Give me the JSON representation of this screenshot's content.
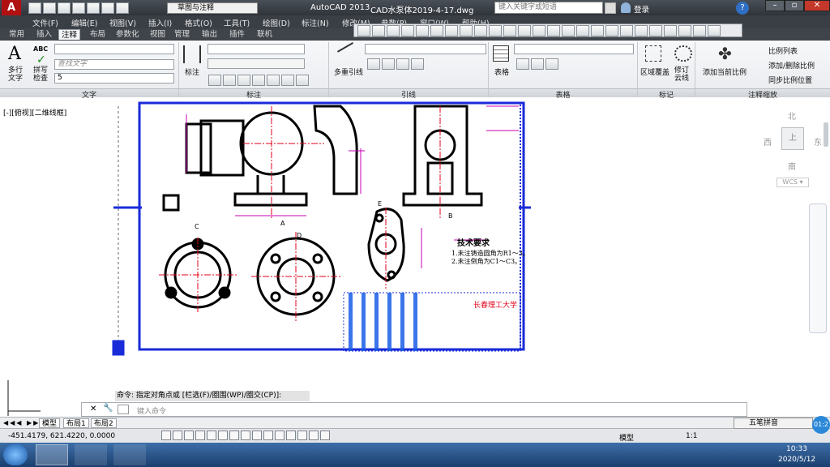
{
  "titlebar": {
    "workspace": "草图与注释",
    "app_title": "AutoCAD 2013",
    "file_title": "CAD水泵体2019-4-17.dwg",
    "search_placeholder": "键入关键字或短语",
    "login": "登录"
  },
  "menu": [
    "文件(F)",
    "编辑(E)",
    "视图(V)",
    "插入(I)",
    "格式(O)",
    "工具(T)",
    "绘图(D)",
    "标注(N)",
    "修改(M)",
    "参数(P)",
    "窗口(W)",
    "帮助(H)"
  ],
  "tabs": [
    "常用",
    "插入",
    "注释",
    "布局",
    "参数化",
    "视图",
    "管理",
    "输出",
    "插件",
    "联机"
  ],
  "active_tab": "注释",
  "ribbon": {
    "text_panel": {
      "title": "文字",
      "multiline_text": "多行文字",
      "spell_check": "拼写检查",
      "abc": "ABC",
      "find_placeholder": "查找文字",
      "height_value": "5"
    },
    "dim_panel": {
      "title": "标注",
      "dim_label": "标注"
    },
    "leader_panel": {
      "title": "引线",
      "multileader": "多重引线"
    },
    "table_panel": {
      "title": "表格",
      "table": "表格"
    },
    "markup_panel": {
      "title": "标记",
      "wipeout": "区域覆盖",
      "revcloud": "修订云线"
    },
    "scale_panel": {
      "title": "注释缩放",
      "add_current": "添加当前比例",
      "scale_list": "比例列表",
      "add_delete": "添加/删除比例",
      "sync": "同步比例位置"
    }
  },
  "viewport_label": "[-][俯视][二维线框]",
  "viewcube": {
    "north": "北",
    "south": "南",
    "east": "东",
    "west": "西",
    "top": "上",
    "wcs": "WCS"
  },
  "drawing": {
    "tech_title": "技术要求",
    "tech_line1": "1.未注铸造圆角为R1～3。",
    "tech_line2": "2.未注倒角为C1～C3。",
    "section_c": "C",
    "section_d": "D",
    "section_e": "E",
    "section_b": "B",
    "section_a": "A",
    "school": "长春理工大学"
  },
  "command": {
    "history": "命令: 指定对角点或 [栏选(F)/圈围(WP)/圈交(CP)]:",
    "placeholder": "键入命令"
  },
  "layout_tabs": [
    "模型",
    "布局1",
    "布局2"
  ],
  "status": {
    "coords": "-451.4179, 621.4220, 0.0000",
    "model": "模型",
    "scale": "1:1"
  },
  "ime": {
    "name": "五笔拼音",
    "bubble": "01:2"
  },
  "taskbar": {
    "time": "10:33",
    "date": "2020/5/12"
  },
  "colors": {
    "drawing_red": "#e0001a",
    "frame_blue": "#1a2bd8",
    "dim_magenta": "#c800b4"
  }
}
